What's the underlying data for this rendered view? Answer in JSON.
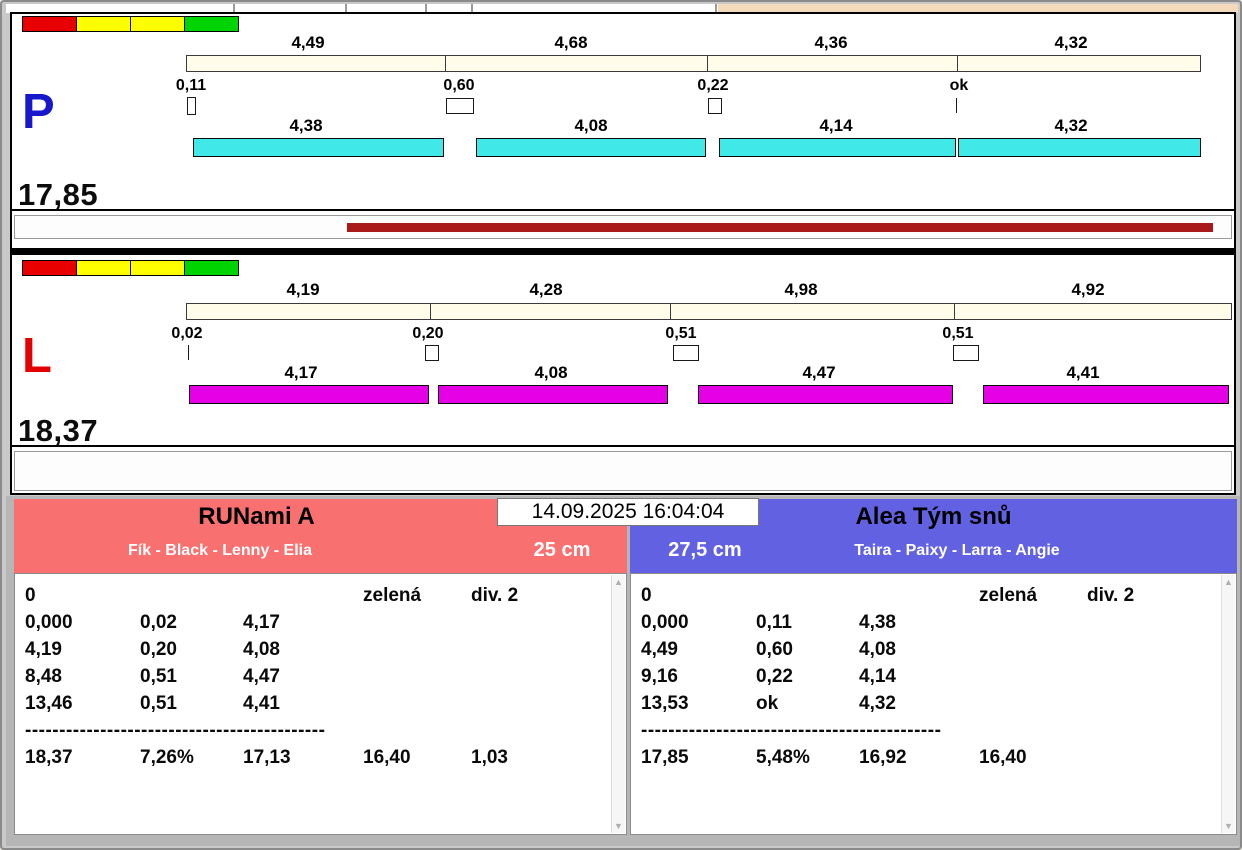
{
  "panels": {
    "p": {
      "letter": "P",
      "total": "17,85",
      "top_times": [
        "4,49",
        "4,68",
        "4,36",
        "4,32"
      ],
      "split_times": [
        "0,11",
        "0,60",
        "0,22",
        "ok"
      ],
      "seg_times": [
        "4,38",
        "4,08",
        "4,14",
        "4,32"
      ],
      "colors": {
        "letter": "#1717cc",
        "bar": "#40e8e8",
        "progress": "#aa1a1a"
      }
    },
    "l": {
      "letter": "L",
      "total": "18,37",
      "top_times": [
        "4,19",
        "4,28",
        "4,98",
        "4,92"
      ],
      "split_times": [
        "0,02",
        "0,20",
        "0,51",
        "0,51"
      ],
      "seg_times": [
        "4,17",
        "4,08",
        "4,47",
        "4,41"
      ],
      "colors": {
        "letter": "#e40000",
        "bar": "#e600e6"
      }
    }
  },
  "legend_colors": [
    "#e80000",
    "#ffff00",
    "#ffff00",
    "#00d400"
  ],
  "icons": {
    "scroll_up": "▲",
    "scroll_down": "▼"
  },
  "footer": {
    "timestamp": "14.09.2025 16:04:04",
    "left_team": {
      "name": "RUNami A",
      "members": "Fík - Black - Lenny - Elia",
      "height": "25 cm",
      "header_color": "#f87070",
      "result_rows": [
        {
          "c0": "0",
          "c3": "zelená",
          "c4": "div. 2"
        },
        {
          "c0": "0,000",
          "c1": "0,02",
          "c2": "4,17"
        },
        {
          "c0": "4,19",
          "c1": "0,20",
          "c2": "4,08"
        },
        {
          "c0": "8,48",
          "c1": "0,51",
          "c2": "4,47"
        },
        {
          "c0": "13,46",
          "c1": "0,51",
          "c2": "4,41"
        }
      ],
      "divider": "--------------------------------------------",
      "summary": {
        "c0": "18,37",
        "c1": "7,26%",
        "c2": "17,13",
        "c3": "16,40",
        "c4": "1,03"
      }
    },
    "right_team": {
      "name": "Alea Tým snů",
      "members": "Taira - Paixy - Larra - Angie",
      "height": "27,5 cm",
      "header_color": "#6161e1",
      "result_rows": [
        {
          "c0": "0",
          "c3": "zelená",
          "c4": "div. 2"
        },
        {
          "c0": "0,000",
          "c1": "0,11",
          "c2": "4,38"
        },
        {
          "c0": "4,49",
          "c1": "0,60",
          "c2": "4,08"
        },
        {
          "c0": "9,16",
          "c1": "0,22",
          "c2": "4,14"
        },
        {
          "c0": "13,53",
          "c1": "ok",
          "c2": "4,32"
        }
      ],
      "divider": "--------------------------------------------",
      "summary": {
        "c0": "17,85",
        "c1": "5,48%",
        "c2": "16,92",
        "c3": "16,40"
      }
    }
  }
}
